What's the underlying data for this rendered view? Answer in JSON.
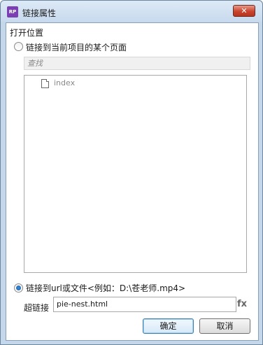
{
  "window": {
    "title": "链接属性",
    "app_icon_text": "RP",
    "close_symbol": "✕"
  },
  "section": {
    "label": "打开位置"
  },
  "option_page": {
    "label": "链接到当前项目的某个页面",
    "selected": false
  },
  "search": {
    "placeholder": "查找"
  },
  "tree": {
    "items": [
      {
        "label": "index",
        "icon": "page-icon"
      }
    ]
  },
  "option_url": {
    "label": "链接到url或文件<例如：D:\\苍老师.mp4>",
    "selected": true
  },
  "hyperlink": {
    "label": "超链接",
    "value": "pie-nest.html",
    "fx_label": "fx"
  },
  "buttons": {
    "ok": "确定",
    "cancel": "取消"
  }
}
